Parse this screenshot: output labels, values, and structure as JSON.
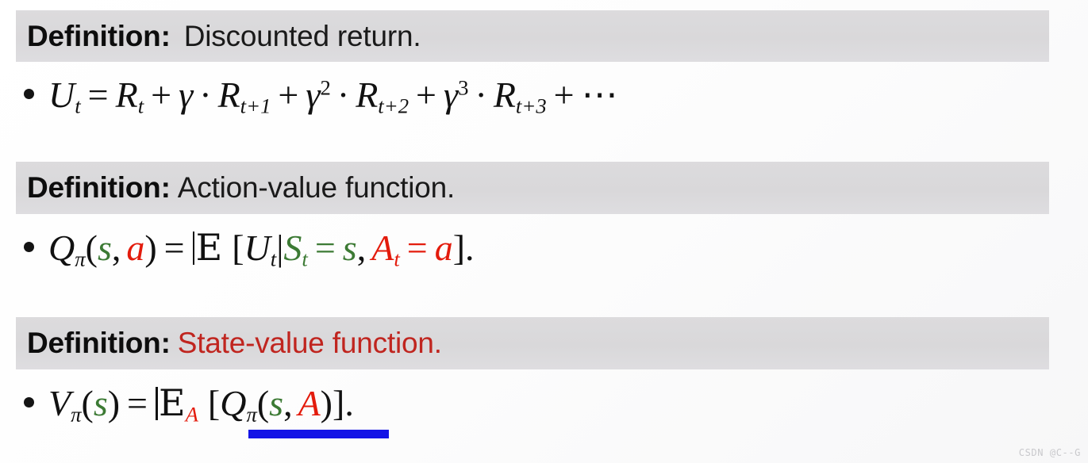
{
  "slide": {
    "watermark": "CSDN @C--G",
    "colors": {
      "band_background": "#d9d8da",
      "accent_red": "#c0251f",
      "math_red": "#e31b0c",
      "math_green": "#3c7a34",
      "highlight_blue": "#1414e6",
      "text_black": "#111111"
    }
  },
  "definitions": [
    {
      "label": "Definition:",
      "title": "Discounted return.",
      "title_color": "black",
      "formula_plain": "U_t = R_t + γ · R_{t+1} + γ² · R_{t+2} + γ³ · R_{t+3} + ⋯",
      "tokens": {
        "lhs_var": "U",
        "lhs_sub": "t",
        "equals": "=",
        "term1_var": "R",
        "term1_sub": "t",
        "plus": "+",
        "gamma": "γ",
        "cdot": "·",
        "term2_var": "R",
        "term2_sub": "t+1",
        "gamma_sup2": "2",
        "term3_var": "R",
        "term3_sub": "t+2",
        "gamma_sup3": "3",
        "term4_var": "R",
        "term4_sub": "t+3",
        "ellipsis": "⋯"
      }
    },
    {
      "label": "Definition:",
      "title": "Action-value function.",
      "title_color": "black",
      "formula_plain": "Q_π(s, a) = E [U_t | S_t = s, A_t = a].",
      "tokens": {
        "lhs_var": "Q",
        "lhs_sub": "π",
        "open_paren": "(",
        "arg_s": "s",
        "comma": ",",
        "arg_a": "a",
        "close_paren": ")",
        "equals": "=",
        "expectation": "E",
        "open_bracket": "[",
        "inner_var": "U",
        "inner_sub": "t",
        "given": "|",
        "cond1_var": "S",
        "cond1_sub": "t",
        "cond1_eq": "=",
        "cond1_val": "s",
        "cond2_var": "A",
        "cond2_sub": "t",
        "cond2_eq": "=",
        "cond2_val": "a",
        "close_bracket": "]",
        "period": "."
      }
    },
    {
      "label": "Definition:",
      "title": "State-value function.",
      "title_color": "red",
      "formula_plain": "V_π(s) = E_A [Q_π(s, A)].",
      "tokens": {
        "lhs_var": "V",
        "lhs_sub": "π",
        "open_paren": "(",
        "arg_s": "s",
        "close_paren": ")",
        "equals": "=",
        "expectation": "E",
        "expectation_sub": "A",
        "open_bracket": "[",
        "inner_var": "Q",
        "inner_sub": "π",
        "inner_open_paren": "(",
        "inner_arg_s": "s",
        "comma": ",",
        "inner_arg_A": "A",
        "inner_close_paren": ")",
        "close_bracket": "]",
        "period": "."
      }
    }
  ],
  "highlight": {
    "target": "Q_π(s, A)",
    "color": "#1414e6"
  }
}
